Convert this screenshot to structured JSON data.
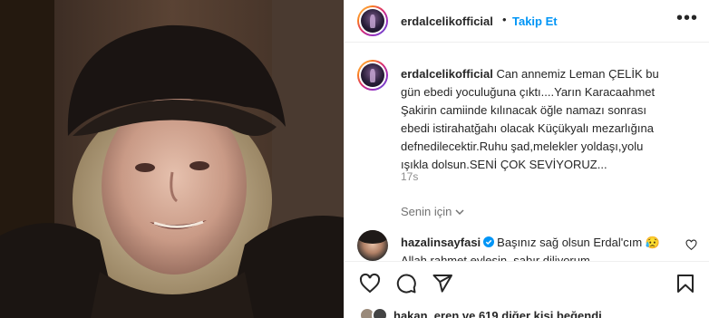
{
  "post": {
    "username": "erdalcelikofficial",
    "separator": "•",
    "follow_label": "Takip Et",
    "more_icon": "more-horizontal-icon"
  },
  "caption": {
    "username": "erdalcelikofficial",
    "text": " Can annemiz Leman ÇELİK bu\ngün ebedi yoculuğuna çıktı....Yarın Karacaahmet\nŞakirin camiinde kılınacak öğle namazı sonrası\nebedi istirahatğahı olacak Küçükyalı mezarlığına\ndefnedilecektir.Ruhu şad,melekler yoldaşı,yolu\nışıkla dolsun.SENİ ÇOK SEVİYORUZ...",
    "time": "17s"
  },
  "for_you": {
    "label": "Senin için"
  },
  "comment": {
    "username": "hazalinsayfasi",
    "text": "Başınız sağ olsun Erdal'cım 😥\nAllah rahmet eylesin, sabır diliyorum"
  },
  "likes": {
    "text": "hakan_eren ve 619 diğer kişi beğendi"
  },
  "colors": {
    "accent": "#0095f6",
    "text": "#262626",
    "muted": "#737373",
    "divider": "#efefef"
  }
}
